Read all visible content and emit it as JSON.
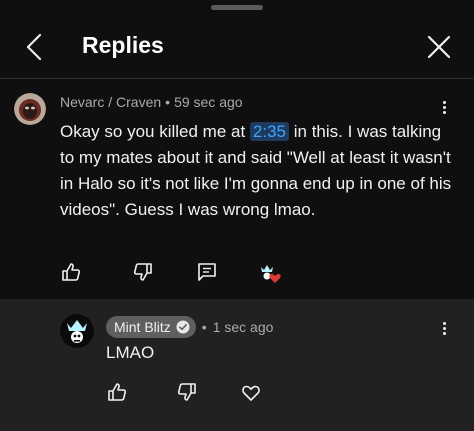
{
  "header": {
    "title": "Replies"
  },
  "parent_comment": {
    "author": "Nevarc / Craven",
    "time": "59 sec ago",
    "text_before": "Okay so you killed me at ",
    "timestamp": "2:35",
    "text_after": " in this. I was talking to my mates about it and said \"Well at least it wasn't in Halo so it's not like I'm gonna end up in one of his videos\". Guess I was wrong lmao."
  },
  "reply": {
    "author": "Mint Blitz",
    "time": "1 sec ago",
    "text": "LMAO"
  },
  "colors": {
    "background": "#0f0f0f",
    "reply_background": "#212121",
    "link": "#3ea6ff",
    "heart": "#e53935"
  }
}
